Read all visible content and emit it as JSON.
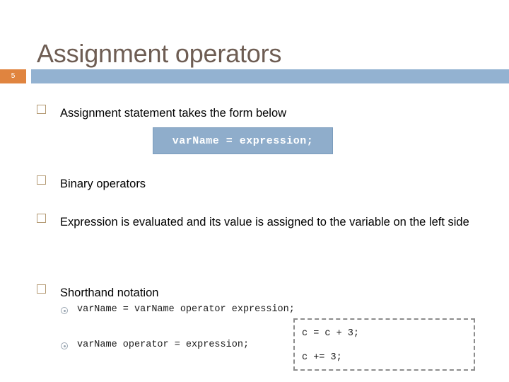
{
  "slide": {
    "title": "Assignment operators",
    "number": "5",
    "accent_orange": "#e0843f",
    "accent_blue": "#93b2d1",
    "title_color": "#6e5d53",
    "bullet_marker_color": "#b49a74"
  },
  "bullets": [
    {
      "id": "form",
      "text": "Assignment statement takes the form below"
    },
    {
      "id": "binary",
      "text": "Binary operators"
    },
    {
      "id": "expr",
      "text": "Expression is evaluated and its value is assigned to the variable on the left side"
    },
    {
      "id": "short",
      "text": "Shorthand notation"
    }
  ],
  "code_box": {
    "text": "varName = expression;",
    "background": "#8fadcb",
    "text_color": "#ffffff"
  },
  "sub_bullets": [
    {
      "id": "compound",
      "text": "varName = varName operator expression;"
    },
    {
      "id": "shorthand",
      "text": "varName operator = expression;"
    }
  ],
  "example_box": {
    "border_style": "dashed",
    "border_color": "#8c8c8c",
    "lines": [
      "c = c + 3;",
      "c += 3;"
    ]
  }
}
